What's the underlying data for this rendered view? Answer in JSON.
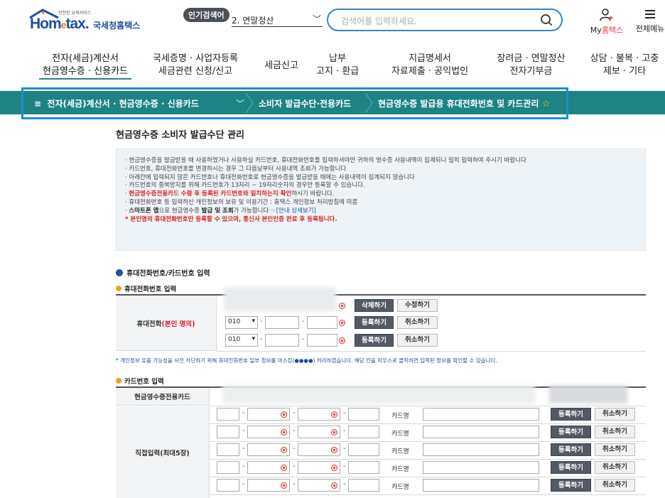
{
  "header": {
    "logo_sub": "안전한 납세서비스",
    "logo_main": "Hom",
    "logo_e": "e",
    "logo_tail": "tax.",
    "logo_kr": "국세청홈택스",
    "popular_badge": "인기검색어",
    "popular_value": "2.  연말정산",
    "search_placeholder": "검색어를 입력하세요.",
    "my_hometax_prefix": "My",
    "my_hometax_suffix": "홈택스",
    "all_menu": "전체메뉴"
  },
  "gnb": [
    {
      "l1": "전자(세금)계산서",
      "l2": "현금영수증 · 신용카드"
    },
    {
      "l1": "국세증명 · 사업자등록",
      "l2": "세금관련 신청/신고"
    },
    {
      "l1": "세금신고",
      "l2": ""
    },
    {
      "l1": "납부",
      "l2": "고지 · 환급"
    },
    {
      "l1": "지급명세서",
      "l2": "자료제출 · 공익법인"
    },
    {
      "l1": "장려금 · 연말정산",
      "l2": "전자기부금"
    },
    {
      "l1": "상담 · 불복 · 고충",
      "l2": "제보 · 기타"
    }
  ],
  "breadcrumb": {
    "menu_icon": "≡",
    "level1": "전자(세금)계산서 · 현금영수증 · 신용카드",
    "level2": "소비자 발급수단·전용카드",
    "level3": "현금영수증 발급용 휴대전화번호 및 카드관리",
    "star": "☆"
  },
  "page_title": "현금영수증 소비자 발급수단 관리",
  "notice": [
    "현금영수증을 발급받을 때 사용하였거나 사용하실 카드번호, 휴대전화번호를 입력하셔야만 귀하의 영수증 사용내역이 집계되니 필히 입력하여 주시기 바랍니다",
    "카드번호, 휴대전화번호를 변경하시는 경우 그 다음날부터 사용내역 조회가 가능합니다",
    "아래칸에 입력되지 않은 카드번호나 휴대전화번호로 현금영수증을 발급받을 때에는 사용내역이 집계되지 않습니다",
    "카드번호의 중복방지를 위해 카드번호가 13자리 ~ 19자리숫자의 경우만 등록할 수 있습니다.",
    "현금영수증전용카드 수령 후 등록된 카드번호와 일치하는지 확인하시기 바랍니다.",
    "휴대전화번호 등 입력하신 개인정보의 보유 및 이용기간 : 홈택스 개인정보 처리방침에 따름",
    "스마트폰 앱으로 현금영수증 발급 및 조회가 가능합니다 ☞[안내 상세보기]",
    "* 본인명의 휴대전화번호만 등록할 수 있으며, 통신사 본인인증 완료 후 등록됩니다."
  ],
  "notice_parts": {
    "line5_red": "현금영수증전용카드 수령 후 등록된 카드번호와 일치하는지 확인",
    "line5_rest": "하시기 바랍니다.",
    "line7_a": "스마트폰 앱",
    "line7_b": "으로 현금영수증 ",
    "line7_c": "발급 및 조회",
    "line7_d": "가 가능합니다 ",
    "line7_link": "☞[안내 상세보기]"
  },
  "phone_section": {
    "title": "휴대전화번호/카드번호 입력",
    "subtitle": "휴대전화번호 입력",
    "label_prefix": "휴대전화",
    "label_red": "(본인 명의)",
    "rows": [
      {
        "prefix": "",
        "btn1": "삭제하기",
        "btn2": "수정하기"
      },
      {
        "prefix": "010",
        "btn1": "등록하기",
        "btn2": "취소하기"
      },
      {
        "prefix": "010",
        "btn1": "등록하기",
        "btn2": "취소하기"
      }
    ],
    "note": "* 개인정보 유출 가능성을 사전 차단하기 위해 휴대전화번호 일부 정보를 마스킹(●●●●) 처리하였습니다. 해당 칸을 마우스로 클릭하면 입력된 정보를 확인할 수 있습니다."
  },
  "card_section": {
    "subtitle": "카드번호 입력",
    "dedicated_label": "현금영수증전용카드",
    "direct_label": "직접입력(최대5장)",
    "card_name_label": "카드명",
    "register": "등록하기",
    "cancel": "취소하기",
    "row_count": 5
  },
  "colors": {
    "brand_blue": "#1e4fa3",
    "teal_bar": "#1d8383",
    "highlight_frame": "#1a8fd6",
    "red": "#e0191f",
    "dark_button": "#535a65"
  }
}
